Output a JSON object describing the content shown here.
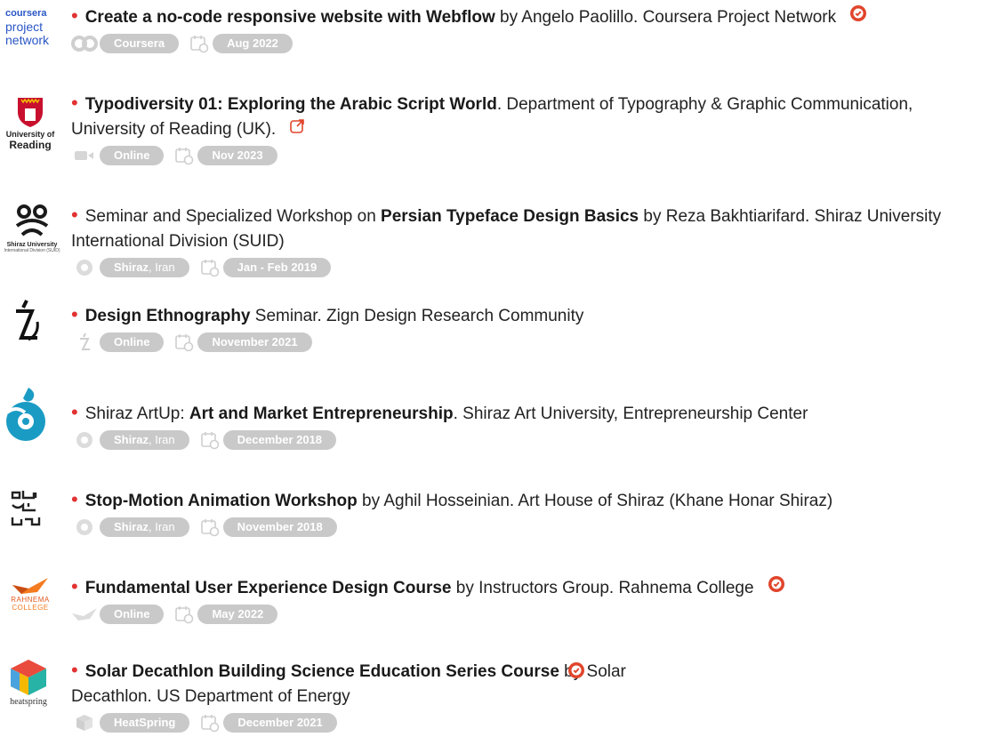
{
  "entries": [
    {
      "logo_text": [
        "coursera",
        "project",
        "network"
      ],
      "parts": [
        {
          "t": "Create a no-code responsive website with Webflow",
          "b": true
        },
        {
          "t": " by Angelo Paolillo. Coursera Project Network",
          "b": false
        }
      ],
      "tags": [
        {
          "bold": "Coursera",
          "lite": ""
        }
      ],
      "date": "Aug 2022",
      "badge": "verified"
    },
    {
      "logo_text": [
        "University of",
        "Reading"
      ],
      "parts": [
        {
          "t": "Typodiversity 01: Exploring the Arabic Script World",
          "b": true
        },
        {
          "t": ". Department of Typography & Graphic Communication, University of Reading (UK).",
          "b": false
        }
      ],
      "tags": [
        {
          "bold": "Online",
          "lite": ""
        }
      ],
      "date": "Nov 2023",
      "badge": "external"
    },
    {
      "logo_text": [
        "Shiraz University",
        "International Division (SUID)"
      ],
      "parts": [
        {
          "t": "Seminar and Specialized Workshop on ",
          "b": false
        },
        {
          "t": "Persian Typeface Design Basics",
          "b": true
        },
        {
          "t": " by Reza Bakhtiarifard. Shiraz University International Division (SUID)",
          "b": false
        }
      ],
      "tags": [
        {
          "bold": "Shiraz",
          "lite": ", Iran"
        }
      ],
      "date": "Jan - Feb 2019",
      "badge": ""
    },
    {
      "logo_text": [],
      "parts": [
        {
          "t": "Design Ethnography",
          "b": true
        },
        {
          "t": " Seminar. Zign Design Research Community",
          "b": false
        }
      ],
      "tags": [
        {
          "bold": "Online",
          "lite": ""
        }
      ],
      "date": "November 2021",
      "badge": ""
    },
    {
      "logo_text": [],
      "parts": [
        {
          "t": "Shiraz ArtUp: ",
          "b": false
        },
        {
          "t": "Art and Market Entrepreneurship",
          "b": true
        },
        {
          "t": ". Shiraz Art University, Entrepreneurship Center",
          "b": false
        }
      ],
      "tags": [
        {
          "bold": "Shiraz",
          "lite": ", Iran"
        }
      ],
      "date": "December 2018",
      "badge": ""
    },
    {
      "logo_text": [],
      "parts": [
        {
          "t": "Stop-Motion Animation Workshop",
          "b": true
        },
        {
          "t": " by Aghil Hosseinian. Art House of Shiraz (Khane Honar Shiraz)",
          "b": false
        }
      ],
      "tags": [
        {
          "bold": "Shiraz",
          "lite": ", Iran"
        }
      ],
      "date": "November 2018",
      "badge": ""
    },
    {
      "logo_text": [
        "RAHNEMA",
        "COLLEGE"
      ],
      "parts": [
        {
          "t": "Fundamental User Experience Design Course",
          "b": true
        },
        {
          "t": " by Instructors Group. Rahnema College",
          "b": false
        }
      ],
      "tags": [
        {
          "bold": "Online",
          "lite": ""
        }
      ],
      "date": "May 2022",
      "badge": "verified"
    },
    {
      "logo_text": [
        "heatspring"
      ],
      "parts": [
        {
          "t": "Solar Decathlon Building Science Education Series Course",
          "b": true
        },
        {
          "t": " by Solar Decathlon. US Department of Energy",
          "b": false
        }
      ],
      "tags": [
        {
          "bold": "HeatSpring",
          "lite": ""
        }
      ],
      "date": "December 2021",
      "badge": "verified"
    }
  ],
  "colors": {
    "bullet": "#e23232",
    "pill": "#c9c9c9",
    "verified": "#e0452b"
  }
}
